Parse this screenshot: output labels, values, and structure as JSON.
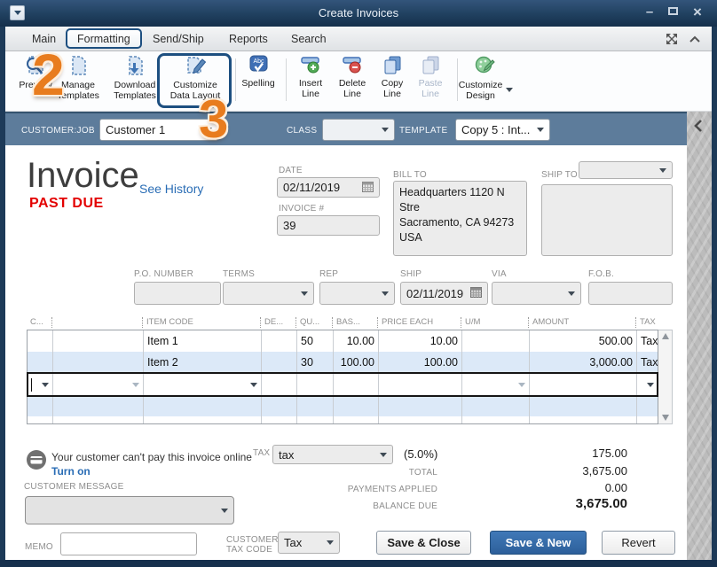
{
  "window": {
    "title": "Create Invoices"
  },
  "tabs": {
    "items": [
      {
        "label": "Main"
      },
      {
        "label": "Formatting",
        "active": true
      },
      {
        "label": "Send/Ship"
      },
      {
        "label": "Reports"
      },
      {
        "label": "Search"
      }
    ]
  },
  "toolbar": {
    "buttons": [
      {
        "label": "Preview"
      },
      {
        "label": "Manage Templates"
      },
      {
        "label": "Download Templates"
      },
      {
        "label": "Customize Data Layout",
        "highlighted": true
      },
      {
        "label": "Spelling"
      },
      {
        "label": "Insert Line"
      },
      {
        "label": "Delete Line"
      },
      {
        "label": "Copy Line"
      },
      {
        "label": "Paste Line",
        "disabled": true
      },
      {
        "label": "Customize Design",
        "dropdown": true
      }
    ]
  },
  "annotations": {
    "step_2": "2",
    "step_3": "3",
    "color": "#e87c1e"
  },
  "customer_bar": {
    "customer_job_label": "CUSTOMER:JOB",
    "customer_job_value": "Customer 1",
    "class_label": "CLASS",
    "class_value": "",
    "template_label": "TEMPLATE",
    "template_value": "Copy 5 : Int..."
  },
  "invoice_header": {
    "title": "Invoice",
    "see_history": "See History",
    "status": "PAST DUE",
    "date_label": "DATE",
    "date_value": "02/11/2019",
    "invoice_number_label": "INVOICE #",
    "invoice_number_value": "39",
    "bill_to_label": "BILL TO",
    "bill_to_lines": [
      "Headquarters 1120 N Stre",
      "Sacramento, CA 94273",
      "USA"
    ],
    "ship_to_label": "SHIP TO",
    "ship_to_value": ""
  },
  "po_fields": {
    "po_number_label": "P.O. NUMBER",
    "po_number_value": "",
    "terms_label": "TERMS",
    "terms_value": "",
    "rep_label": "REP",
    "rep_value": "",
    "ship_label": "SHIP",
    "ship_value": "02/11/2019",
    "via_label": "VIA",
    "via_value": "",
    "fob_label": "F.O.B.",
    "fob_value": ""
  },
  "items_table": {
    "columns": [
      "C...",
      "",
      "ITEM CODE",
      "DE...",
      "QU...",
      "BAS...",
      "PRICE EACH",
      "U/M",
      "AMOUNT",
      "TAX"
    ],
    "rows": [
      {
        "cells": [
          "",
          "",
          "Item 1",
          "",
          "50",
          "10.00",
          "10.00",
          "",
          "500.00",
          "Tax"
        ]
      },
      {
        "cells": [
          "",
          "",
          "Item 2",
          "",
          "30",
          "100.00",
          "100.00",
          "",
          "3,000.00",
          "Tax"
        ]
      }
    ]
  },
  "payment_notice": {
    "message": "Your customer can't pay this invoice online",
    "action": "Turn on"
  },
  "totals": {
    "tax_label": "TAX",
    "tax_value": "tax",
    "tax_rate": "(5.0%)",
    "tax_amount": "175.00",
    "total_label": "TOTAL",
    "total_value": "3,675.00",
    "payments_applied_label": "PAYMENTS APPLIED",
    "payments_applied_value": "0.00",
    "balance_due_label": "BALANCE DUE",
    "balance_due_value": "3,675.00"
  },
  "footer": {
    "customer_message_label": "CUSTOMER MESSAGE",
    "customer_message_value": "",
    "memo_label": "MEMO",
    "memo_value": "",
    "customer_tax_code_label_line1": "CUSTOMER",
    "customer_tax_code_label_line2": "TAX CODE",
    "customer_tax_code_value": "Tax",
    "save_close_button": "Save & Close",
    "save_new_button": "Save & New",
    "revert_button": "Revert"
  }
}
